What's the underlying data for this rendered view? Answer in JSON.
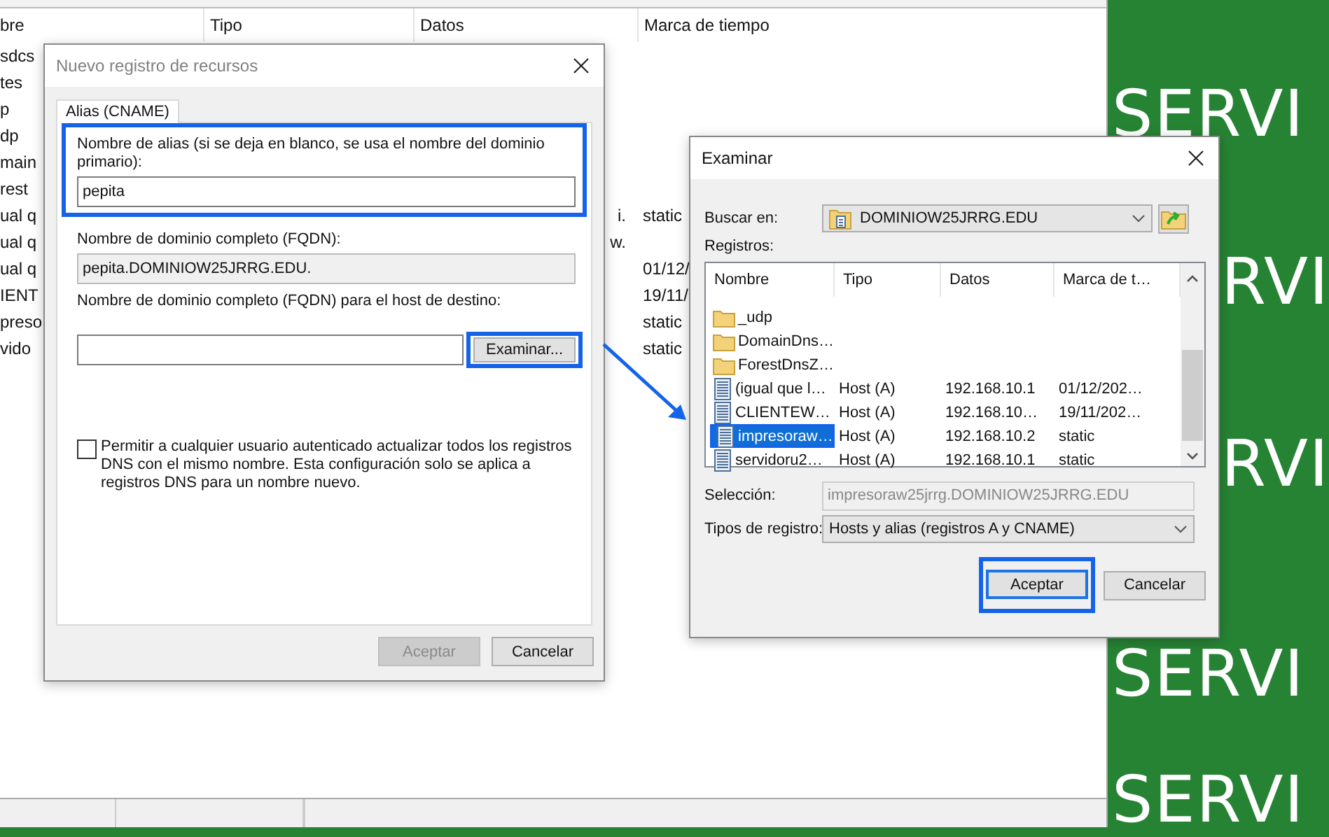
{
  "background_window": {
    "columns": [
      "bre",
      "Tipo",
      "Datos",
      "Marca de tiempo"
    ],
    "rows": [
      {
        "name": "sdcs"
      },
      {
        "name": "tes"
      },
      {
        "name": "p"
      },
      {
        "name": "dp"
      },
      {
        "name": "main"
      },
      {
        "name": "rest"
      },
      {
        "name": "ual q",
        "data": "i.",
        "timestamp": "static"
      },
      {
        "name": "ual q",
        "data": "w."
      },
      {
        "name": "ual q",
        "timestamp": "01/12/"
      },
      {
        "name": "IENT",
        "timestamp": "19/11/"
      },
      {
        "name": "preso",
        "timestamp": "static"
      },
      {
        "name": "vido",
        "timestamp": "static"
      }
    ]
  },
  "new_record_dialog": {
    "title": "Nuevo registro de recursos",
    "tabs": [
      {
        "label": "Alias (CNAME)",
        "selected": true
      }
    ],
    "alias_label": "Nombre de alias (si se deja en blanco, se usa el nombre del dominio primario):",
    "alias_value": "pepita",
    "fqdn_label": "Nombre de dominio completo (FQDN):",
    "fqdn_value": "pepita.DOMINIOW25JRRG.EDU.",
    "target_label": "Nombre de dominio completo (FQDN) para el host de destino:",
    "browse_button": "Examinar...",
    "checkbox": {
      "label": "Permitir a cualquier usuario autenticado actualizar todos los registros DNS con el mismo nombre. Esta configuración solo se aplica a registros DNS para un nombre nuevo.",
      "checked": false
    },
    "buttons": [
      {
        "label": "Aceptar",
        "disabled": true
      },
      {
        "label": "Cancelar",
        "disabled": false
      }
    ]
  },
  "browse_dialog": {
    "title": "Examinar",
    "look_in_label": "Buscar en:",
    "look_in_value": "DOMINIOW25JRRG.EDU",
    "records_label": "Registros:",
    "columns": [
      "Nombre",
      "Tipo",
      "Datos",
      "Marca de t…"
    ],
    "rows": [
      {
        "kind": "folder",
        "name": "_udp",
        "selected": false
      },
      {
        "kind": "folder",
        "name": "DomainDns…",
        "selected": false
      },
      {
        "kind": "folder",
        "name": "ForestDnsZ…",
        "selected": false
      },
      {
        "kind": "record",
        "name": "(igual que l…",
        "type": "Host (A)",
        "data": "192.168.10.1",
        "timestamp": "01/12/202…",
        "selected": false
      },
      {
        "kind": "record",
        "name": "CLIENTEW…",
        "type": "Host (A)",
        "data": "192.168.10…",
        "timestamp": "19/11/202…",
        "selected": false
      },
      {
        "kind": "record",
        "name": "impresoraw…",
        "type": "Host (A)",
        "data": "192.168.10.2",
        "timestamp": "static",
        "selected": true
      },
      {
        "kind": "record",
        "name": "servidoru2…",
        "type": "Host (A)",
        "data": "192.168.10.1",
        "timestamp": "static",
        "selected": false
      }
    ],
    "selection_label": "Selección:",
    "selection_value": "impresoraw25jrrg.DOMINIOW25JRRG.EDU",
    "record_types_label": "Tipos de registro:",
    "record_types_value": "Hosts y alias (registros A y CNAME)",
    "buttons": [
      {
        "label": "Aceptar",
        "default": true
      },
      {
        "label": "Cancelar",
        "default": false
      }
    ]
  },
  "wallpaper": {
    "texts": [
      "SERVI",
      "RVI",
      "RVI",
      "SERVI",
      "SERVI"
    ]
  }
}
